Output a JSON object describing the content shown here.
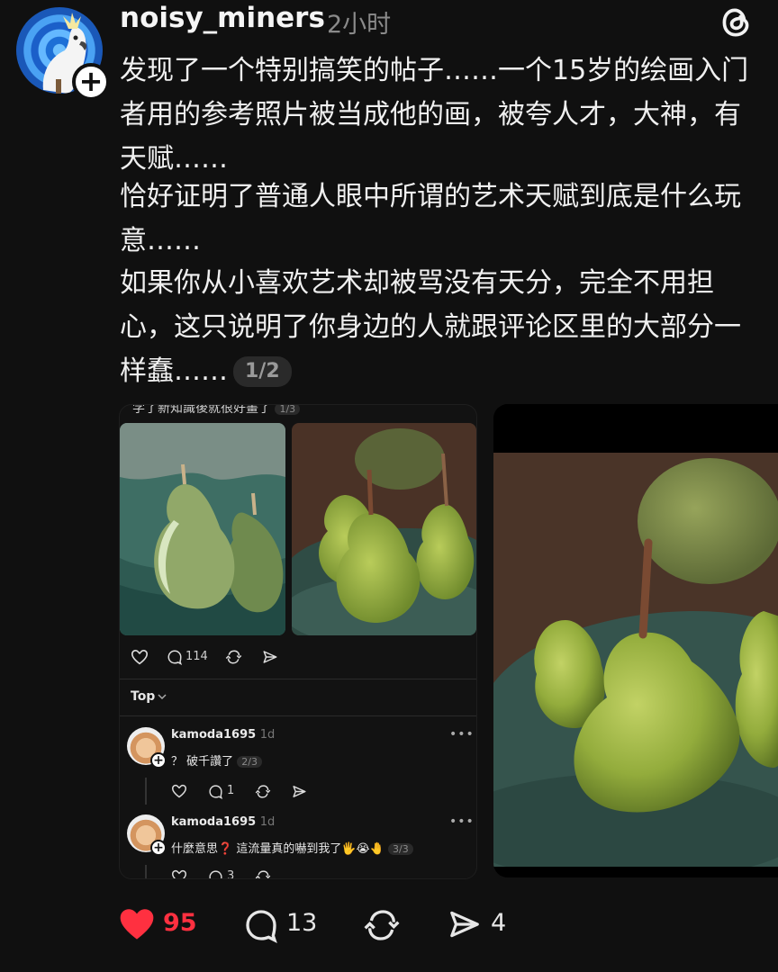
{
  "post": {
    "username": "noisy_miners",
    "time": "2小时",
    "paragraph1": "发现了一个特别搞笑的帖子……一个15岁的绘画入门者用的参考照片被当成他的画，被夸人才，大神，有天赋……",
    "paragraph2": "恰好证明了普通人眼中所谓的艺术天赋到底是什么玩意……",
    "paragraph3": "如果你从小喜欢艺术却被骂没有天分，完全不用担心，这只说明了你身边的人就跟评论区里的大部分一样蠢……",
    "page_badge": "1/2"
  },
  "screenshot": {
    "top_text": "学了新知識後就很好畫了",
    "top_badge": "1/3",
    "reply_count": "114",
    "sort_label": "Top",
    "comments": [
      {
        "user": "kamoda1695",
        "age": "1d",
        "text": "？ 破千讚了",
        "badge": "2/3",
        "replies": "1"
      },
      {
        "user": "kamoda1695",
        "age": "1d",
        "text": "什麼意思❓ 這流量真的嚇到我了🖐😭🤚",
        "badge": "3/3",
        "replies": "3"
      }
    ]
  },
  "actions": {
    "likes": "95",
    "comments": "13",
    "shares": "4"
  },
  "colors": {
    "background": "#101010",
    "like_red": "#ff3040",
    "avatar_blue": "#1d6fd6"
  },
  "icons": [
    "threads-logo-icon",
    "plus-icon",
    "heart-icon",
    "comment-icon",
    "repost-icon",
    "share-icon",
    "chevron-down-icon",
    "more-icon"
  ]
}
